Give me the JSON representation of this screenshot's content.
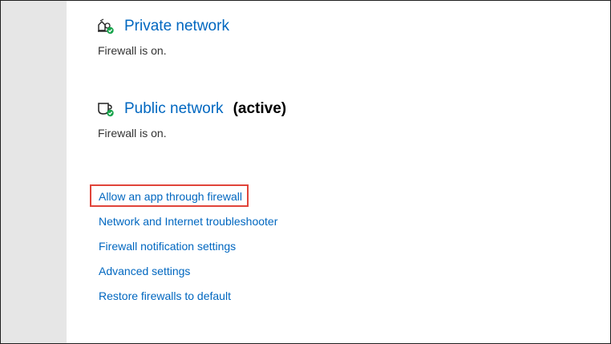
{
  "private_network": {
    "title": "Private network",
    "status": "Firewall is on.",
    "icon": "private-network-icon"
  },
  "public_network": {
    "title": "Public network",
    "active_label": "(active)",
    "status": "Firewall is on.",
    "icon": "public-network-icon"
  },
  "links": [
    {
      "label": "Allow an app through firewall",
      "highlighted": true
    },
    {
      "label": "Network and Internet troubleshooter"
    },
    {
      "label": "Firewall notification settings"
    },
    {
      "label": "Advanced settings"
    },
    {
      "label": "Restore firewalls to default"
    }
  ],
  "colors": {
    "link": "#0067c0",
    "highlight_border": "#e0443a",
    "status_ok": "#16a34a",
    "side_pane": "#e6e6e6"
  }
}
